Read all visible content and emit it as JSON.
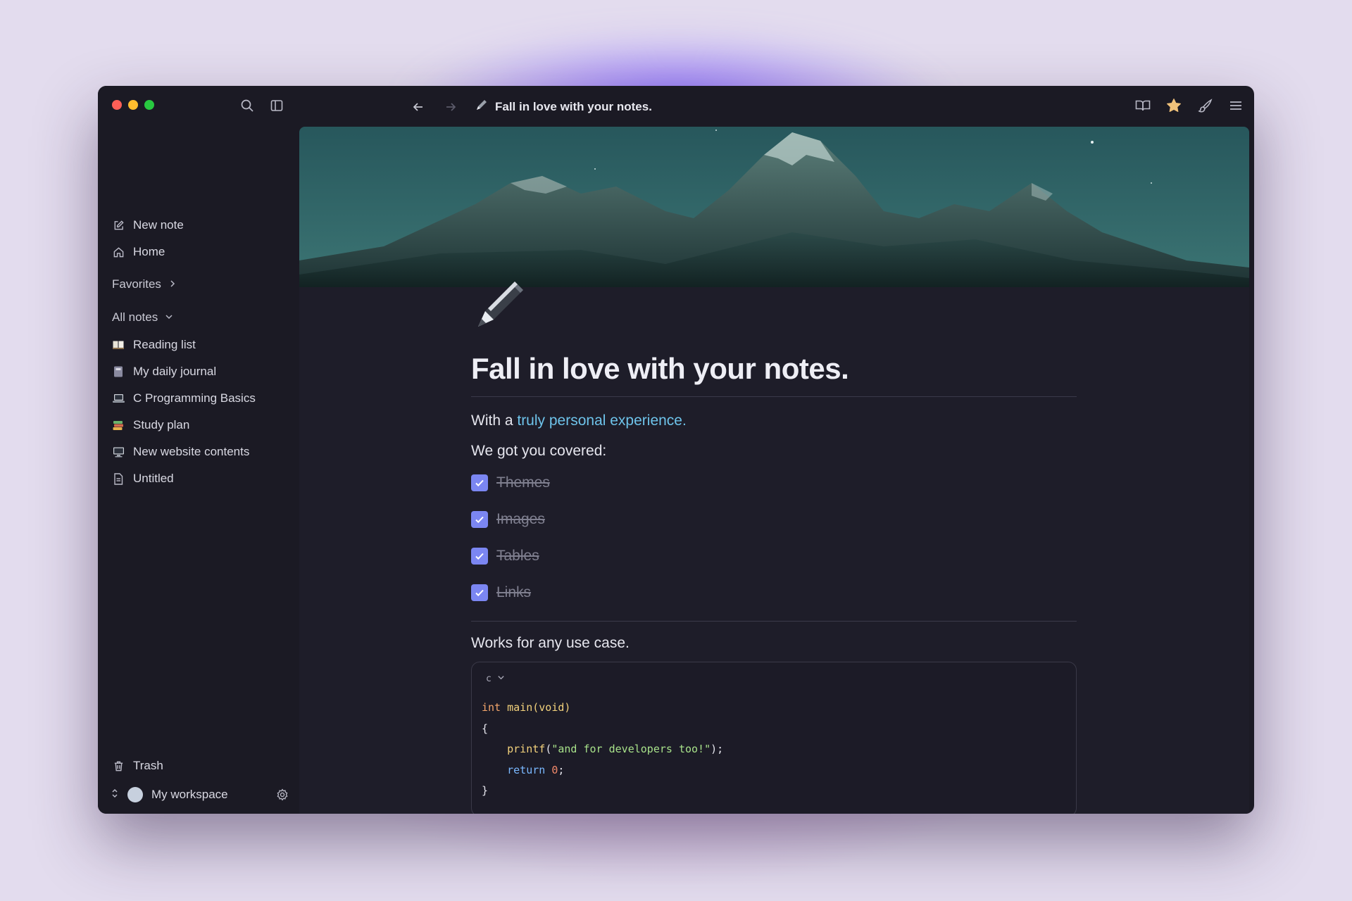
{
  "window": {
    "title": "Fall in love with your notes."
  },
  "sidebar": {
    "new_note": "New note",
    "home": "Home",
    "favorites": "Favorites",
    "all_notes": "All notes",
    "notes": [
      {
        "label": "Reading list",
        "icon": "book-icon",
        "color": "#e8e4d8"
      },
      {
        "label": "My daily journal",
        "icon": "notebook-icon",
        "color": "#8a8aa0"
      },
      {
        "label": "C Programming Basics",
        "icon": "laptop-icon",
        "color": "#cfd3da"
      },
      {
        "label": "Study plan",
        "icon": "books-icon",
        "color": "#d46b4e"
      },
      {
        "label": "New website contents",
        "icon": "computer-icon",
        "color": "#cfd3da"
      },
      {
        "label": "Untitled",
        "icon": "document-icon",
        "color": "#b9b9c6"
      }
    ],
    "trash": "Trash",
    "workspace": "My workspace"
  },
  "document": {
    "title": "Fall in love with your notes.",
    "intro_prefix": "With a ",
    "intro_link": "truly personal experience.",
    "covered": "We got you covered:",
    "todos": [
      {
        "label": "Themes",
        "checked": true
      },
      {
        "label": "Images",
        "checked": true
      },
      {
        "label": "Tables",
        "checked": true
      },
      {
        "label": "Links",
        "checked": true
      }
    ],
    "use_case": "Works for any use case.",
    "code": {
      "language": "c",
      "line1_type": "int",
      "line1_fn": "main(void)",
      "line2": "{",
      "line3_fn": "printf",
      "line3_open": "(",
      "line3_str": "\"and for developers too!\"",
      "line3_close": ");",
      "line4_kw": "return",
      "line4_num": "0",
      "line4_end": ";",
      "line5": "}"
    }
  },
  "colors": {
    "accent": "#7b86f2",
    "link": "#6ec3ea",
    "background": "#1e1d29"
  }
}
